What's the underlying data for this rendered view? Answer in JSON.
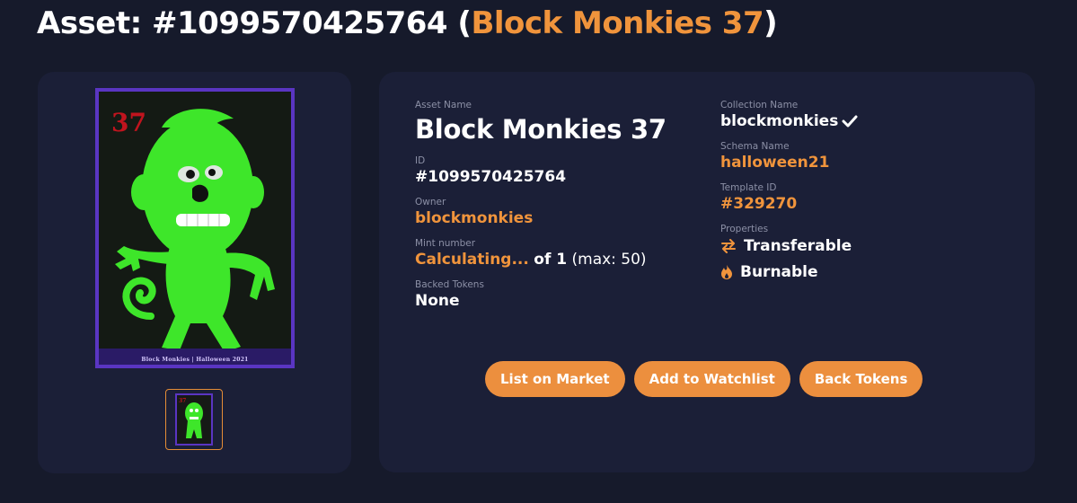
{
  "title": {
    "prefix": "Asset: #1099570425764 (",
    "name": "Block Monkies 37",
    "suffix": ")"
  },
  "nft": {
    "number": "37",
    "caption": "Block Monkies | Halloween 2021",
    "colors": {
      "frame": "#5a35c2",
      "monkey": "#3ee62a",
      "number": "#c0141e"
    }
  },
  "details": {
    "asset_name_label": "Asset Name",
    "asset_name": "Block Monkies 37",
    "id_label": "ID",
    "id": "#1099570425764",
    "owner_label": "Owner",
    "owner": "blockmonkies",
    "mint_label": "Mint number",
    "mint_value": "Calculating...",
    "mint_of": "of 1",
    "mint_max": "(max: 50)",
    "backed_label": "Backed Tokens",
    "backed": "None",
    "collection_label": "Collection Name",
    "collection": "blockmonkies",
    "schema_label": "Schema Name",
    "schema": "halloween21",
    "template_label": "Template ID",
    "template": "#329270",
    "properties_label": "Properties",
    "properties": [
      {
        "icon": "transfer-arrows-icon",
        "label": "Transferable"
      },
      {
        "icon": "flame-icon",
        "label": "Burnable"
      }
    ]
  },
  "actions": {
    "list": "List on Market",
    "watch": "Add to Watchlist",
    "back": "Back Tokens"
  },
  "colors": {
    "accent": "#f0943c",
    "background": "#161a2b",
    "card": "#1b1f37"
  }
}
